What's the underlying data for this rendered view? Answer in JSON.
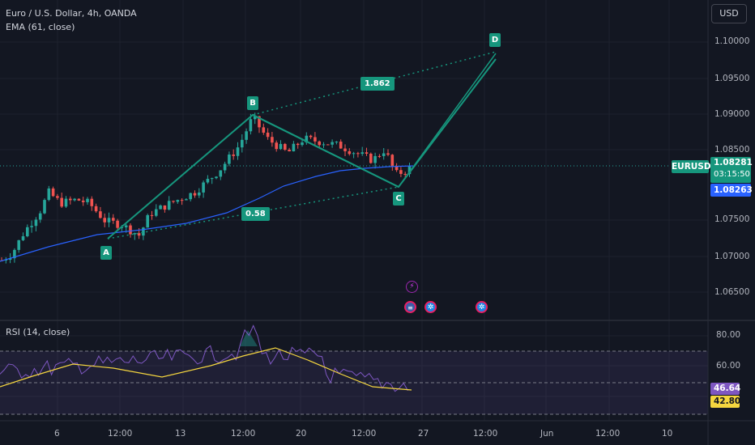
{
  "header": {
    "symbol_title": "Euro / U.S. Dollar, 4h, OANDA",
    "ema_label": "EMA (61, close)",
    "currency_button": "USD"
  },
  "price_axis": [
    "1.10000",
    "1.09500",
    "1.09000",
    "1.08500",
    "1.07500",
    "1.07000",
    "1.06500"
  ],
  "price_badges": {
    "symbol": "EURUSD",
    "last_price": "1.08281",
    "countdown": "03:15:50",
    "ema_value": "1.08263"
  },
  "pattern": {
    "points": [
      "A",
      "B",
      "C",
      "D"
    ],
    "ratio_ac": "0.58",
    "ratio_bd": "1.862"
  },
  "rsi": {
    "label": "RSI (14, close)",
    "axis": [
      "80.00",
      "60.00"
    ],
    "value": "46.64",
    "ma_value": "42.80"
  },
  "time_axis": [
    "6",
    "12:00",
    "13",
    "12:00",
    "20",
    "12:00",
    "27",
    "12:00",
    "Jun",
    "12:00",
    "10"
  ],
  "events": [
    "lightning-icon",
    "us-flag-icon",
    "globe-icon",
    "globe-icon"
  ],
  "colors": {
    "background": "#131722",
    "up": "#26a69a",
    "down": "#ef5350",
    "pattern": "#16967d",
    "ema": "#2962ff",
    "rsi": "#7e57c2",
    "rsi_ma": "#f5d63f"
  }
}
